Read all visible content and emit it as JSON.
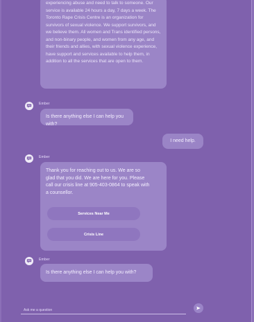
{
  "chat": {
    "first_bubble_text": "experiencing abuse and need to talk to someone. Our service is available 24 hours a day, 7 days a week. The Toronto Rape Crisis Centre is an organization for survivors of sexual violence. We support survivors, and we believe them. All women and Trans identified persons, and non-binary people, and women from any age, and their friends and allies, with sexual violence experience, have support and services available to help them, in addition to all the services that are open to them.",
    "bot_name": "Ember",
    "bot_question_1": "Is there anything else I can help you with?",
    "user_message": "I need help.",
    "bot_reply_name": "Ember",
    "bot_reply_text": "Thank you for reaching out to us. We are so glad that you did. We are here for you. Please call our crisis line at 905-403-0864 to speak with a counsellor.",
    "option_1": "Services Near Me",
    "option_2": "Crisis Line",
    "bot_question_2_name": "Ember",
    "bot_question_2": "Is there anything else I can help you with?"
  },
  "composer": {
    "placeholder": "Ask me a question"
  },
  "icons": {
    "bot_avatar": "chat-bubble-icon",
    "send": "send-icon"
  }
}
